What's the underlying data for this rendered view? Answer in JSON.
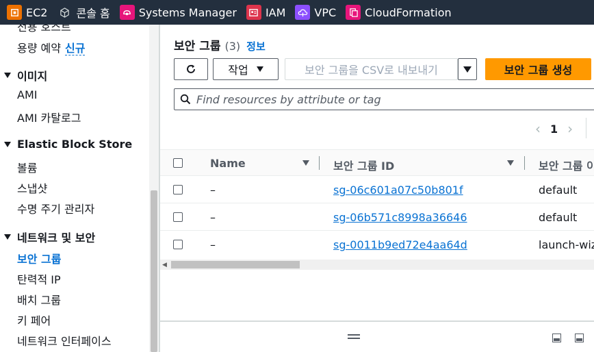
{
  "favorites": [
    {
      "label": "EC2",
      "icon": "ec2-icon",
      "color": "#ed7100"
    },
    {
      "label": "콘솔 홈",
      "icon": "cube-icon",
      "color": "#232f3e"
    },
    {
      "label": "Systems Manager",
      "icon": "systems-manager-icon",
      "color": "#e7157b"
    },
    {
      "label": "IAM",
      "icon": "iam-icon",
      "color": "#dd344c"
    },
    {
      "label": "VPC",
      "icon": "vpc-icon",
      "color": "#8c4fff"
    },
    {
      "label": "CloudFormation",
      "icon": "cloudformation-icon",
      "color": "#e7157b"
    }
  ],
  "sidebar": {
    "top_partial": "전용 호스트",
    "capacity_reservation": "용량 예약",
    "new_badge": "신규",
    "images_group": "이미지",
    "ami": "AMI",
    "ami_catalog": "AMI 카탈로그",
    "ebs_group": "Elastic Block Store",
    "volumes": "볼륨",
    "snapshots": "스냅샷",
    "lifecycle_manager": "수명 주기 관리자",
    "network_group": "네트워크 및 보안",
    "security_groups": "보안 그룹",
    "elastic_ips": "탄력적 IP",
    "placement_groups": "배치 그룹",
    "key_pairs": "키 페어",
    "network_interfaces": "네트워크 인터페이스"
  },
  "main": {
    "title": "보안 그룹",
    "count": "(3)",
    "info_link": "정보",
    "actions_label": "작업",
    "export_label": "보안 그룹을 CSV로 내보내기",
    "create_label": "보안 그룹 생성",
    "search_placeholder": "Find resources by attribute or tag",
    "current_page": "1",
    "columns": [
      "Name",
      "보안 그룹 ID",
      "보안 그룹 이름"
    ],
    "rows": [
      {
        "name": "–",
        "id": "sg-06c601a07c50b801f",
        "group_name": "default"
      },
      {
        "name": "–",
        "id": "sg-06b571c8998a36646",
        "group_name": "default"
      },
      {
        "name": "–",
        "id": "sg-0011b9ed72e4aa64d",
        "group_name": "launch-wiz"
      }
    ]
  },
  "colors": {
    "accent_link": "#0972d3",
    "primary_button": "#ff9900",
    "topbar_bg": "#232f3e"
  }
}
